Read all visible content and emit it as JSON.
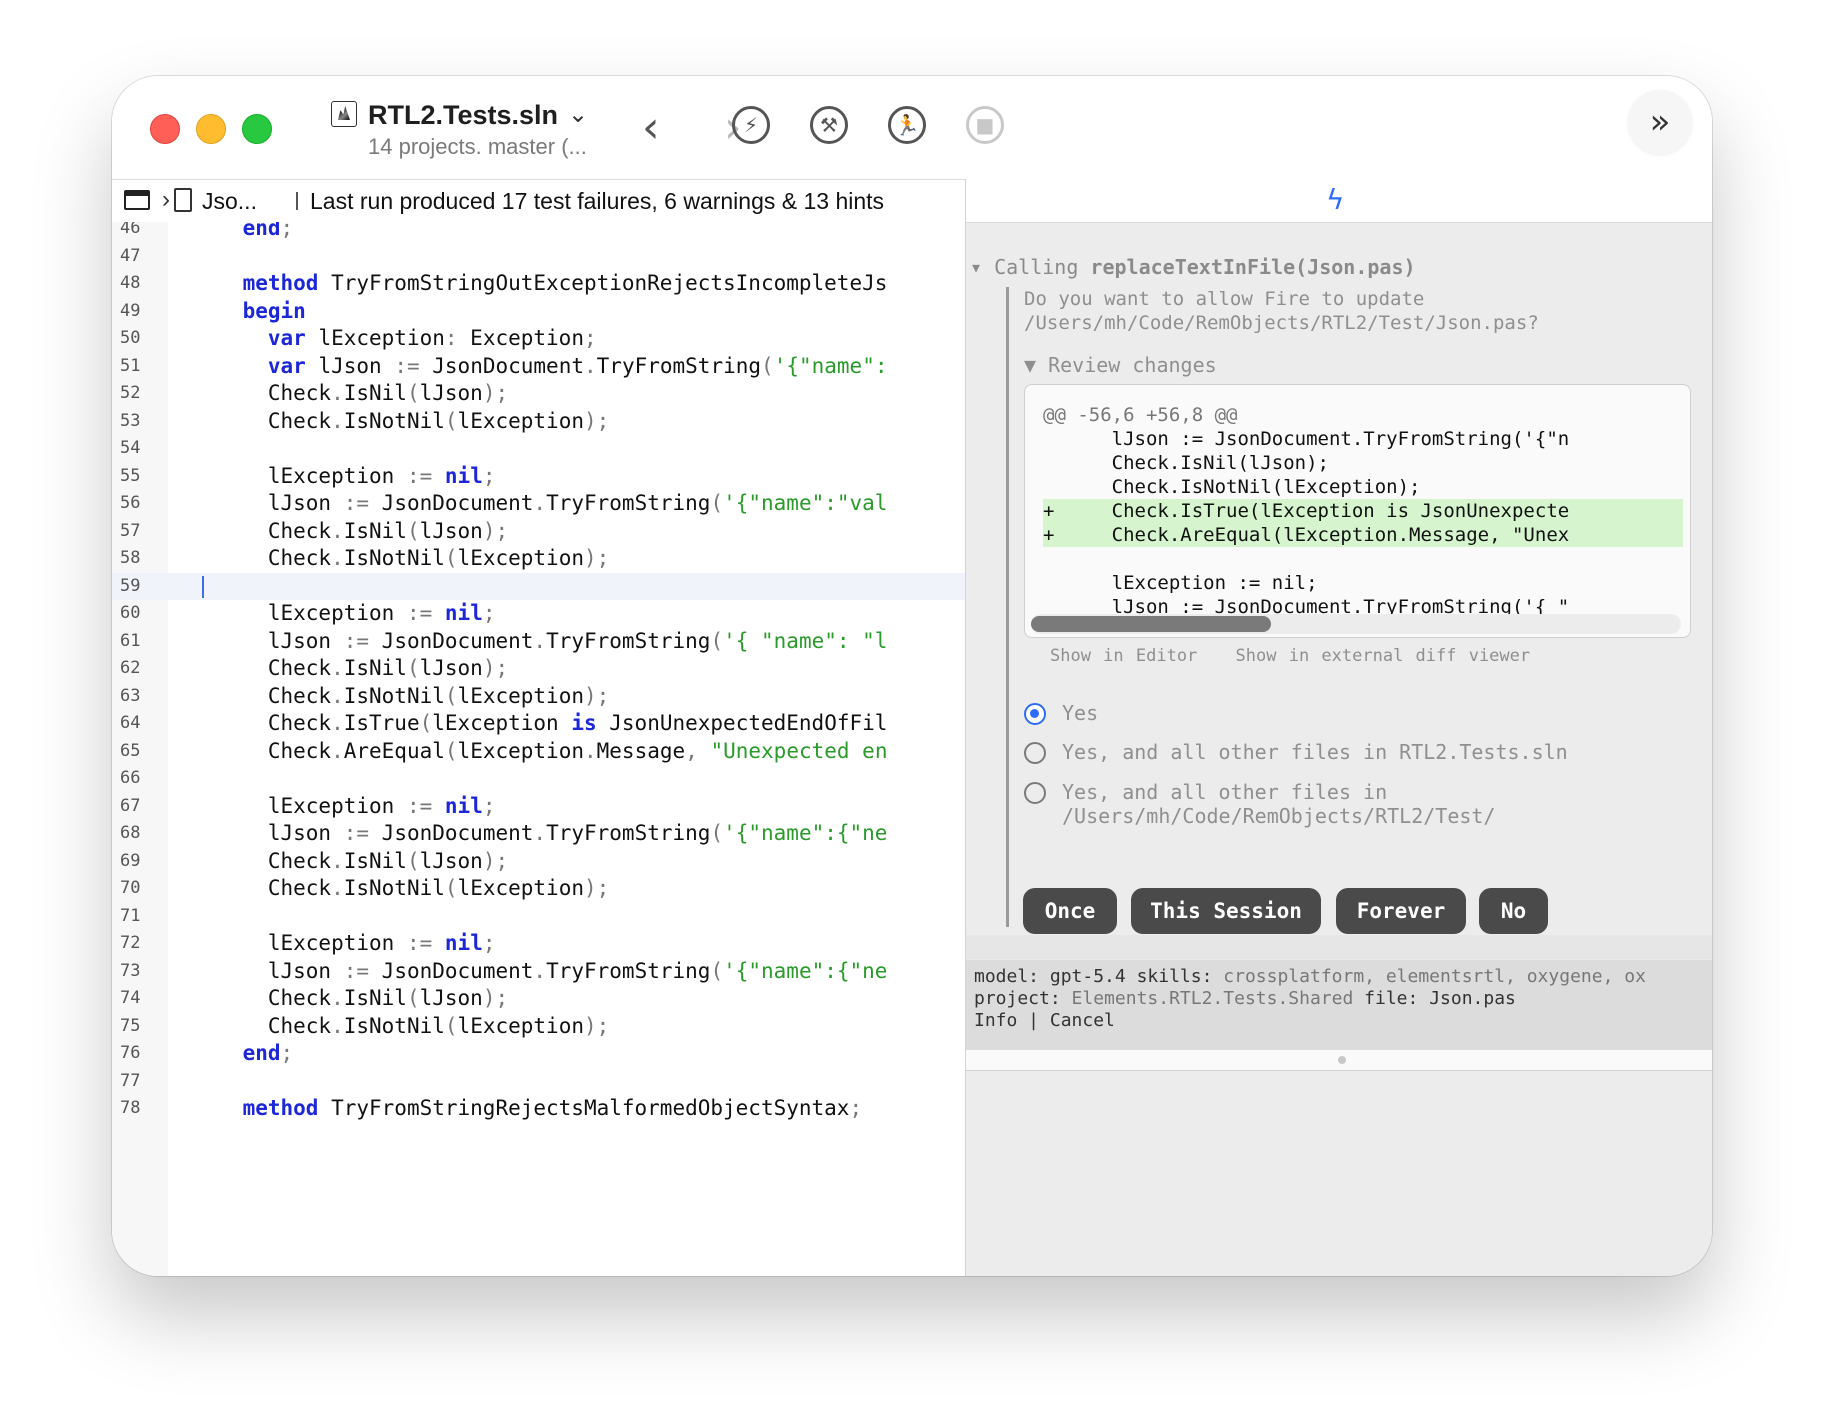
{
  "titlebar": {
    "solution_name": "RTL2.Tests.sln",
    "subtitle": "14 projects. master (...",
    "chevron": "⌄",
    "back_glyph": "‹",
    "forward_glyph": "›",
    "toolbar_icons": [
      "lightning-icon",
      "build-hammer-icon",
      "run-person-icon",
      "stop-icon"
    ],
    "more_glyph": "»"
  },
  "pathbar": {
    "file": "Jso...",
    "status": "Last run produced 17 test failures, 6 warnings & 13 hints"
  },
  "editor": {
    "lines": [
      {
        "n": "46",
        "text": "    end;"
      },
      {
        "n": "47",
        "text": ""
      },
      {
        "n": "48",
        "text": "    method TryFromStringOutExceptionRejectsIncompleteJs"
      },
      {
        "n": "49",
        "text": "    begin"
      },
      {
        "n": "50",
        "text": "      var lException: Exception;"
      },
      {
        "n": "51",
        "text": "      var lJson := JsonDocument.TryFromString('{\"name\":"
      },
      {
        "n": "52",
        "text": "      Check.IsNil(lJson);"
      },
      {
        "n": "53",
        "text": "      Check.IsNotNil(lException);"
      },
      {
        "n": "54",
        "text": ""
      },
      {
        "n": "55",
        "text": "      lException := nil;"
      },
      {
        "n": "56",
        "text": "      lJson := JsonDocument.TryFromString('{\"name\":\"val"
      },
      {
        "n": "57",
        "text": "      Check.IsNil(lJson);"
      },
      {
        "n": "58",
        "text": "      Check.IsNotNil(lException);"
      },
      {
        "n": "59",
        "text": ""
      },
      {
        "n": "60",
        "text": "      lException := nil;"
      },
      {
        "n": "61",
        "text": "      lJson := JsonDocument.TryFromString('{ \"name\": \"l"
      },
      {
        "n": "62",
        "text": "      Check.IsNil(lJson);"
      },
      {
        "n": "63",
        "text": "      Check.IsNotNil(lException);"
      },
      {
        "n": "64",
        "text": "      Check.IsTrue(lException is JsonUnexpectedEndOfFil"
      },
      {
        "n": "65",
        "text": "      Check.AreEqual(lException.Message, \"Unexpected en"
      },
      {
        "n": "66",
        "text": ""
      },
      {
        "n": "67",
        "text": "      lException := nil;"
      },
      {
        "n": "68",
        "text": "      lJson := JsonDocument.TryFromString('{\"name\":{\"ne"
      },
      {
        "n": "69",
        "text": "      Check.IsNil(lJson);"
      },
      {
        "n": "70",
        "text": "      Check.IsNotNil(lException);"
      },
      {
        "n": "71",
        "text": ""
      },
      {
        "n": "72",
        "text": "      lException := nil;"
      },
      {
        "n": "73",
        "text": "      lJson := JsonDocument.TryFromString('{\"name\":{\"ne"
      },
      {
        "n": "74",
        "text": "      Check.IsNil(lJson);"
      },
      {
        "n": "75",
        "text": "      Check.IsNotNil(lException);"
      },
      {
        "n": "76",
        "text": "    end;"
      },
      {
        "n": "77",
        "text": ""
      },
      {
        "n": "78",
        "text": "    method TryFromStringRejectsMalformedObjectSyntax;"
      }
    ],
    "current_line": "59"
  },
  "assistant": {
    "calling_prefix": "Calling ",
    "calling_fn": "replaceTextInFile(Json.pas)",
    "permission_lines": [
      "Do you want to allow Fire to update",
      "/Users/mh/Code/RemObjects/RTL2/Test/Json.pas?"
    ],
    "review_label": "Review changes",
    "diff": [
      {
        "kind": "hdr",
        "text": "@@ -56,6 +56,8 @@"
      },
      {
        "kind": "ctx",
        "text": "      lJson := JsonDocument.TryFromString('{\"n"
      },
      {
        "kind": "ctx",
        "text": "      Check.IsNil(lJson);"
      },
      {
        "kind": "ctx",
        "text": "      Check.IsNotNil(lException);"
      },
      {
        "kind": "add",
        "text": "+     Check.IsTrue(lException is JsonUnexpecte"
      },
      {
        "kind": "add",
        "text": "+     Check.AreEqual(lException.Message, \"Unex"
      },
      {
        "kind": "ctx",
        "text": ""
      },
      {
        "kind": "ctx",
        "text": "      lException := nil;"
      },
      {
        "kind": "ctx",
        "text": "      lJson := JsonDocument.TryFromString('{ \""
      }
    ],
    "diff_links": [
      "Show in Editor",
      "Show in external diff viewer"
    ],
    "options": [
      {
        "lines": [
          "Yes"
        ],
        "selected": true
      },
      {
        "lines": [
          "Yes, and all other files in RTL2.Tests.sln"
        ],
        "selected": false
      },
      {
        "lines": [
          "Yes, and all other files in",
          "/Users/mh/Code/RemObjects/RTL2/Test/"
        ],
        "selected": false
      }
    ],
    "buttons": [
      "Once",
      "This Session",
      "Forever",
      "No"
    ],
    "footer": {
      "model_label": "model:",
      "model_value": "gpt-5.4",
      "skills_label": "skills:",
      "skills_value": "crossplatform, elementsrtl, oxygene, ox",
      "project_label": "project:",
      "project_value": "Elements.RTL2.Tests.Shared",
      "file_label": "file:",
      "file_value": "Json.pas",
      "actions": "Info | Cancel"
    }
  },
  "colors": {
    "accent": "#2f6cf5",
    "keyword": "#1d27d8",
    "string": "#2a9a2a",
    "diff_add": "#d6f5cf",
    "button_bg": "#4a4a4a"
  }
}
